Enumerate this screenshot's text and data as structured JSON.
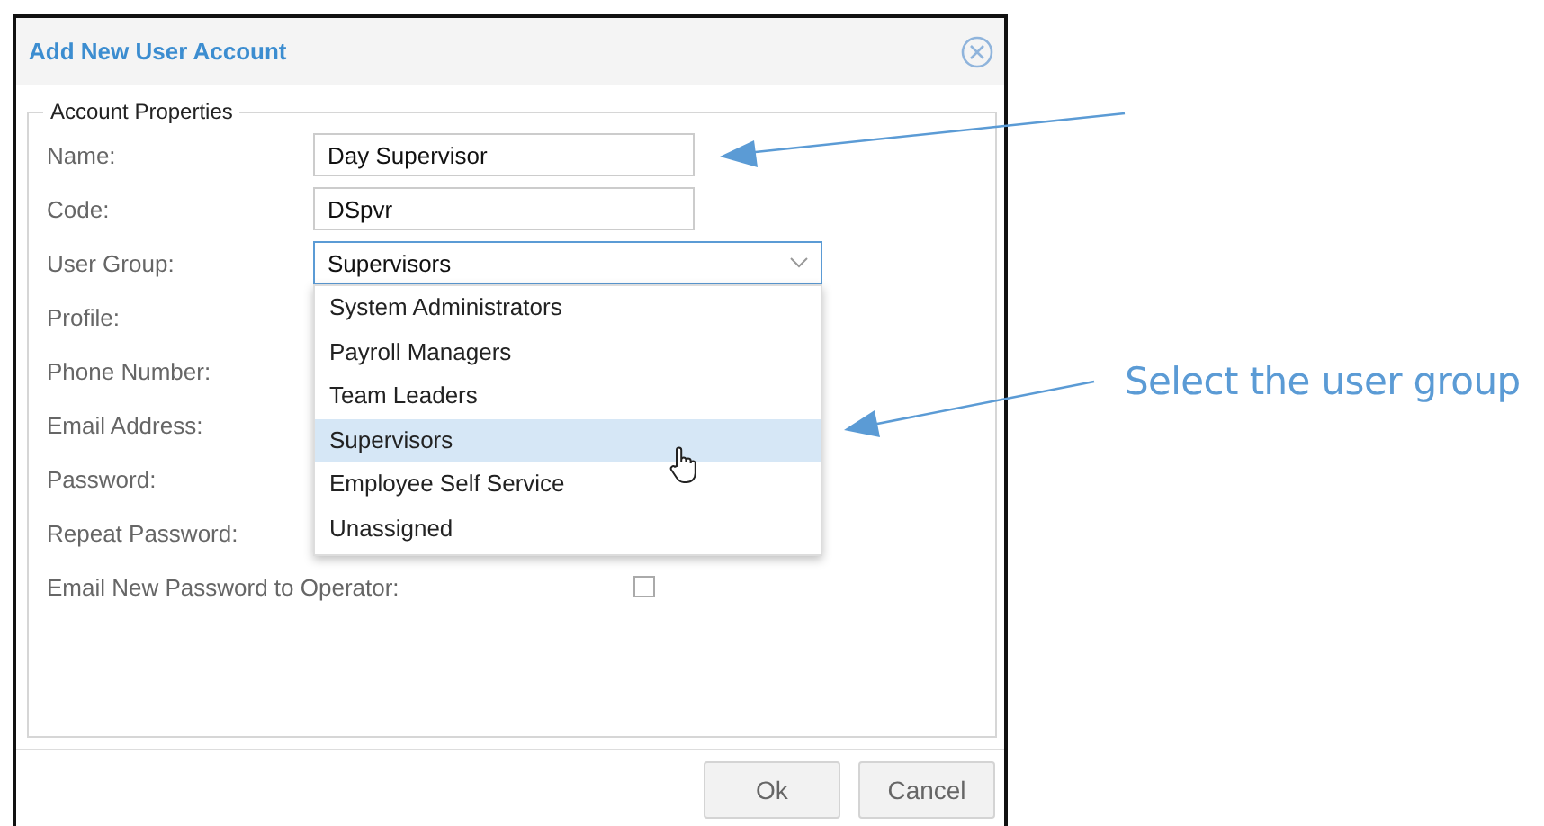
{
  "dialog": {
    "title": "Add New User Account",
    "group_label": "Account Properties",
    "fields": [
      {
        "label": "Name:",
        "kind": "text",
        "value": "Day Supervisor"
      },
      {
        "label": "Code:",
        "kind": "text",
        "value": "DSpvr"
      },
      {
        "label": "User Group:",
        "kind": "select",
        "value": "Supervisors"
      },
      {
        "label": "Profile:",
        "kind": "covered"
      },
      {
        "label": "Phone Number:",
        "kind": "covered"
      },
      {
        "label": "Email Address:",
        "kind": "covered"
      },
      {
        "label": "Password:",
        "kind": "covered"
      },
      {
        "label": "Repeat Password:",
        "kind": "covered"
      },
      {
        "label": "Email New Password to Operator:",
        "kind": "checkbox",
        "checked": false
      }
    ],
    "dropdown": {
      "options": [
        {
          "label": "System Administrators",
          "selected": false
        },
        {
          "label": "Payroll Managers",
          "selected": false
        },
        {
          "label": "Team Leaders",
          "selected": false
        },
        {
          "label": "Supervisors",
          "selected": true
        },
        {
          "label": "Employee Self Service",
          "selected": false
        },
        {
          "label": "Unassigned",
          "selected": false
        }
      ]
    },
    "buttons": [
      {
        "label": "Ok"
      },
      {
        "label": "Cancel"
      }
    ]
  },
  "annotation": {
    "caption": "Select the user group"
  }
}
